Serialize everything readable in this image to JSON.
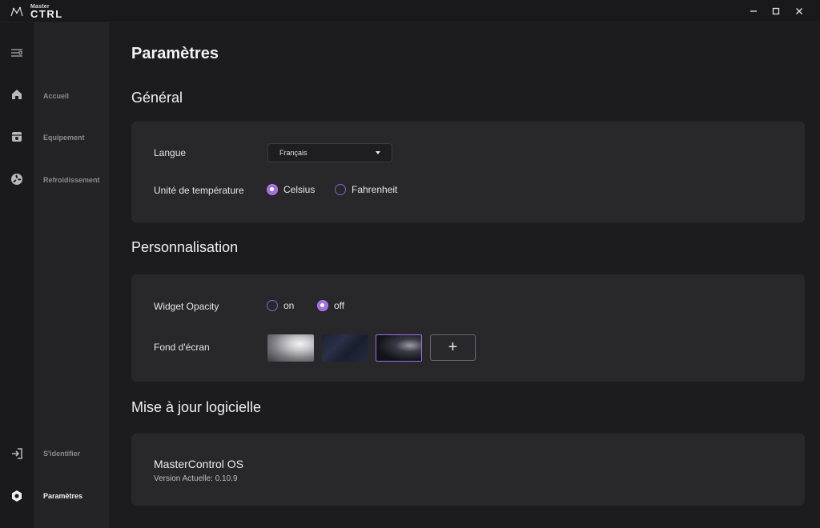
{
  "app": {
    "logo_small": "Master",
    "logo_big": "CTRL"
  },
  "window": {
    "minimize": "–",
    "maximize": "☐",
    "close": "✕"
  },
  "sidebar": {
    "items": [
      {
        "label": "Accueil",
        "icon": "home-icon"
      },
      {
        "label": "Equipement",
        "icon": "device-icon"
      },
      {
        "label": "Refroidissement",
        "icon": "fan-icon"
      },
      {
        "label": "S'identifier",
        "icon": "login-icon"
      },
      {
        "label": "Paramètres",
        "icon": "settings-icon"
      }
    ]
  },
  "page": {
    "title": "Paramètres"
  },
  "general": {
    "title": "Général",
    "language_label": "Langue",
    "language_value": "Français",
    "temp_label": "Unité de température",
    "temp_options": [
      "Celsius",
      "Fahrenheit"
    ],
    "temp_selected": "Celsius"
  },
  "personalization": {
    "title": "Personnalisation",
    "opacity_label": "Widget Opacity",
    "opacity_options": [
      "on",
      "off"
    ],
    "opacity_selected": "off",
    "wallpaper_label": "Fond d'écran",
    "add_label": "+"
  },
  "update": {
    "title": "Mise à jour logicielle",
    "product": "MasterControl OS",
    "version": "Version Actuelle: 0.10.9"
  },
  "colors": {
    "accent": "#a26fe0",
    "background": "#1c1c1f",
    "card": "#28282b"
  }
}
